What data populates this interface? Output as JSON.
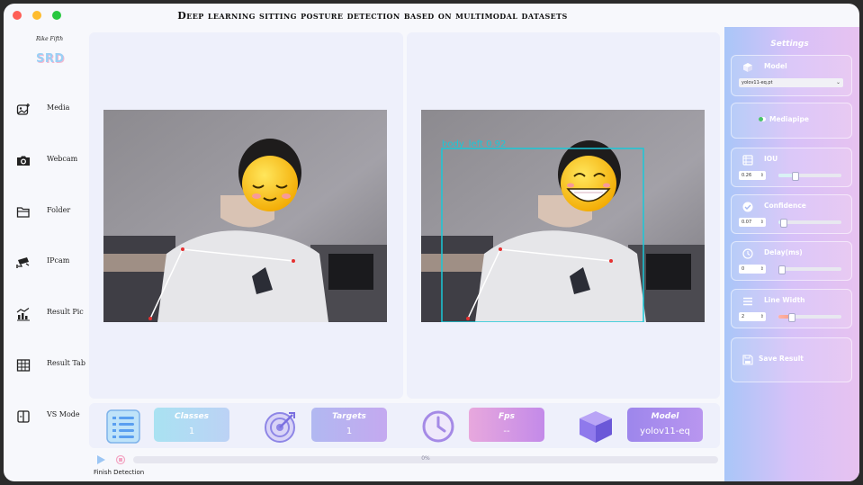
{
  "window": {
    "title": "Deep learning sitting posture detection based on multimodal datasets"
  },
  "sidebar": {
    "author": "Rike Fifth",
    "logo": "SRD",
    "items": [
      {
        "label": "Media",
        "icon": "image-add-icon"
      },
      {
        "label": "Webcam",
        "icon": "camera-icon"
      },
      {
        "label": "Folder",
        "icon": "folder-icon"
      },
      {
        "label": "IPcam",
        "icon": "cctv-icon"
      },
      {
        "label": "Result Pic",
        "icon": "chart-icon"
      },
      {
        "label": "Result Tab",
        "icon": "table-icon"
      },
      {
        "label": "VS Mode",
        "icon": "split-view-icon"
      }
    ]
  },
  "detection": {
    "label": "body_left",
    "score": "0.92"
  },
  "stats": {
    "classes": {
      "label": "Classes",
      "value": "1"
    },
    "targets": {
      "label": "Targets",
      "value": "1"
    },
    "fps": {
      "label": "Fps",
      "value": "--"
    },
    "model": {
      "label": "Model",
      "value": "yolov11-eq"
    }
  },
  "progress": {
    "text": "0%",
    "value": 0
  },
  "status": "Finish Detection",
  "settings": {
    "title": "Settings",
    "model": {
      "label": "Model",
      "selected": "yolov11-eq.pt"
    },
    "mediapipe": {
      "label": "Mediapipe"
    },
    "iou": {
      "label": "IOU",
      "value": "0.26",
      "fraction": 0.26
    },
    "confidence": {
      "label": "Confidence",
      "value": "0.07",
      "fraction": 0.07
    },
    "delay": {
      "label": "Delay(ms)",
      "value": "0",
      "fraction": 0.0
    },
    "line_width": {
      "label": "Line Width",
      "value": "2",
      "fraction": 0.2
    },
    "save": {
      "label": "Save Result"
    }
  },
  "colors": {
    "accent": "#7b5cf0",
    "detection_box": "#19c8d8",
    "keypoint": "#e53030"
  }
}
